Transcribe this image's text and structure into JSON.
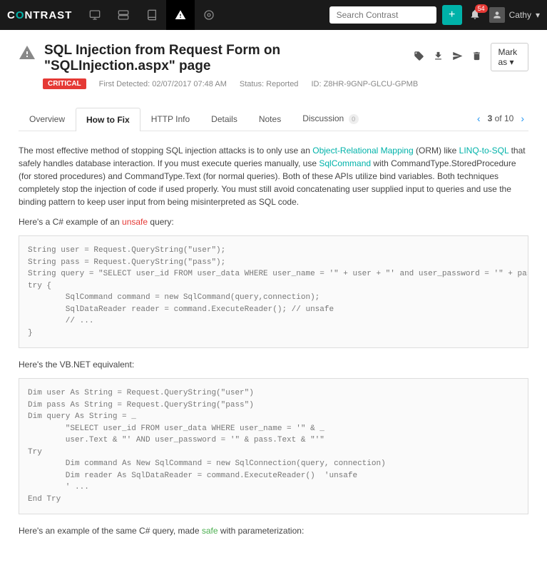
{
  "topbar": {
    "logo_pre": "C",
    "logo_accent": "O",
    "logo_post": "NTRAST",
    "search_placeholder": "Search Contrast",
    "notif_count": "54",
    "username": "Cathy"
  },
  "header": {
    "title": "SQL Injection from Request Form on \"SQLInjection.aspx\" page",
    "mark_as": "Mark as",
    "severity": "CRITICAL",
    "first_detected_label": "First Detected:",
    "first_detected_value": "02/07/2017 07:48 AM",
    "status_label": "Status:",
    "status_value": "Reported",
    "id_label": "ID:",
    "id_value": "Z8HR-9GNP-GLCU-GPMB"
  },
  "tabs": {
    "overview": "Overview",
    "howto": "How to Fix",
    "http": "HTTP Info",
    "details": "Details",
    "notes": "Notes",
    "discussion": "Discussion",
    "discussion_count": "0"
  },
  "pager": {
    "pos": "3",
    "sep": "of",
    "total": "10"
  },
  "body": {
    "p1a": "The most effective method of stopping SQL injection attacks is to only use an ",
    "p1_link1": "Object-Relational Mapping",
    "p1b": " (ORM) like ",
    "p1_link2": "LINQ-to-SQL",
    "p1c": " that safely handles database interaction. If you must execute queries manually, use ",
    "p1_link3": "SqlCommand",
    "p1d": " with CommandType.StoredProcedure (for stored procedures) and CommandType.Text (for normal queries). Both of these APIs utilize bind variables. Both techniques completely stop the injection of code if used properly. You must still avoid concatenating user supplied input to queries and use the binding pattern to keep user input from being misinterpreted as SQL code.",
    "p2a": "Here's a C# example of an ",
    "p2_unsafe": "unsafe",
    "p2b": " query:",
    "code1": "String user = Request.QueryString(\"user\");\nString pass = Request.QueryString(\"pass\");\nString query = \"SELECT user_id FROM user_data WHERE user_name = '\" + user + \"' and user_password = '\" + pass +\"'\";\ntry {\n        SqlCommand command = new SqlCommand(query,connection);\n        SqlDataReader reader = command.ExecuteReader(); // unsafe\n        // ...\n}",
    "p3": "Here's the VB.NET equivalent:",
    "code2": "Dim user As String = Request.QueryString(\"user\")\nDim pass As String = Request.QueryString(\"pass\")\nDim query As String = _\n        \"SELECT user_id FROM user_data WHERE user_name = '\" & _\n        user.Text & \"' AND user_password = '\" & pass.Text & \"'\"\nTry\n        Dim command As New SqlCommand = new SqlConnection(query, connection)\n        Dim reader As SqlDataReader = command.ExecuteReader()  'unsafe\n        ' ...\nEnd Try",
    "p4a": "Here's an example of the same C# query, made ",
    "p4_safe": "safe",
    "p4b": " with parameterization:"
  }
}
